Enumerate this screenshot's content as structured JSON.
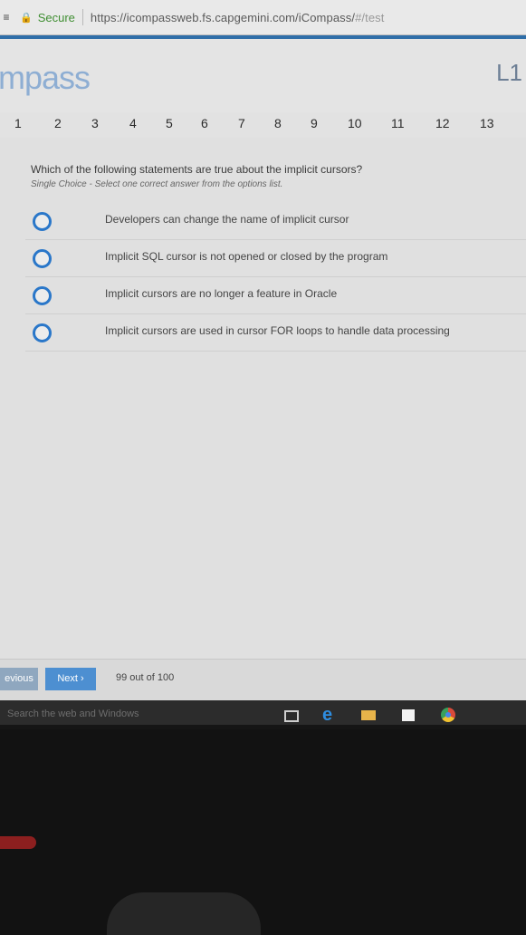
{
  "browser": {
    "secure_label": "Secure",
    "url_host": "https://icompassweb.fs.capgemini.com/iCompass/",
    "url_path": "#/test"
  },
  "app": {
    "logo_text": "mpass",
    "level_label": "L1"
  },
  "question_nav": [
    "1",
    "2",
    "3",
    "4",
    "5",
    "6",
    "7",
    "8",
    "9",
    "10",
    "11",
    "12",
    "13"
  ],
  "question": {
    "text": "Which of the following statements are true about the implicit cursors?",
    "hint": "Single Choice - Select one correct answer from the options list.",
    "options": [
      "Developers can change the name of implicit cursor",
      "Implicit SQL cursor is not opened or closed by the program",
      "Implicit cursors are no longer a feature in Oracle",
      "Implicit cursors are used in cursor FOR loops to handle data processing"
    ]
  },
  "footer": {
    "previous_label": "evious",
    "next_label": "Next ›",
    "progress_text": "99 out of 100"
  },
  "taskbar": {
    "search_placeholder": "Search the web and Windows"
  }
}
